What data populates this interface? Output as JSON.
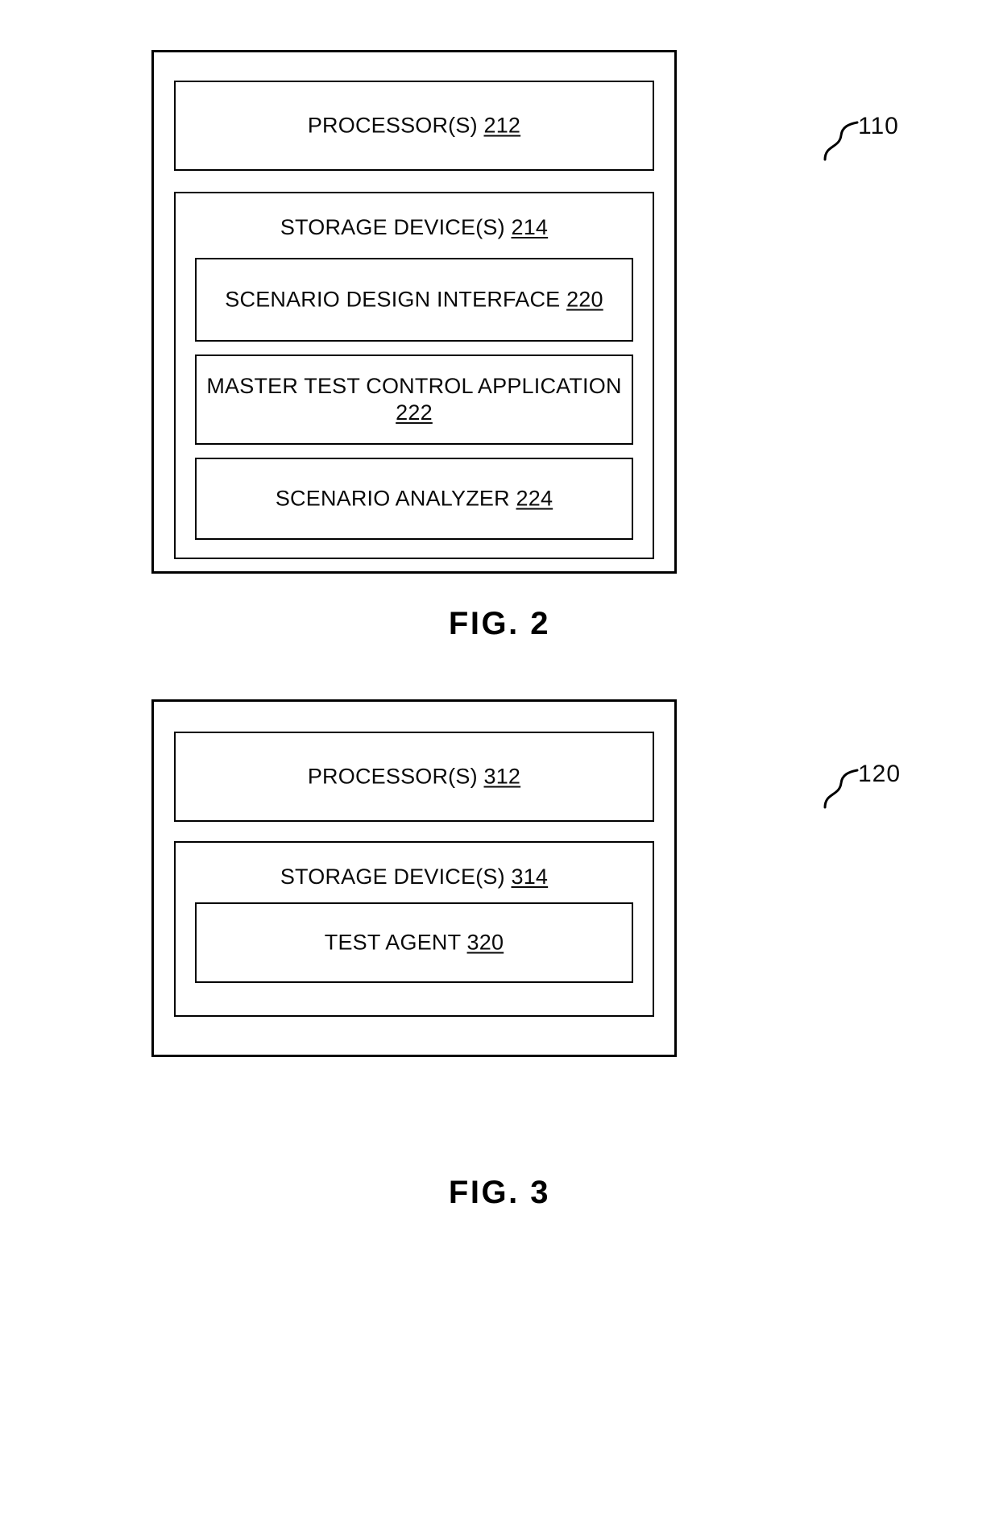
{
  "document": {
    "type": "patent-drawing-sheet",
    "background_color": "#ffffff",
    "line_color": "#000000"
  },
  "figures": [
    {
      "id": "fig2",
      "caption": "FIG. 2",
      "callout": "110",
      "blocks": {
        "processor": {
          "text": "PROCESSOR(S)",
          "ref": "212"
        },
        "storage": {
          "text": "STORAGE DEVICE(S)",
          "ref": "214"
        },
        "children": [
          {
            "text": "SCENARIO DESIGN INTERFACE",
            "ref": "220"
          },
          {
            "text": "MASTER TEST CONTROL APPLICATION",
            "ref": "222"
          },
          {
            "text": "SCENARIO ANALYZER",
            "ref": "224"
          }
        ]
      }
    },
    {
      "id": "fig3",
      "caption": "FIG. 3",
      "callout": "120",
      "blocks": {
        "processor": {
          "text": "PROCESSOR(S)",
          "ref": "312"
        },
        "storage": {
          "text": "STORAGE DEVICE(S)",
          "ref": "314"
        },
        "children": [
          {
            "text": "TEST AGENT",
            "ref": "320"
          }
        ]
      }
    }
  ],
  "fig2": {
    "caption": "FIG. 2",
    "callout": "110",
    "processor_text": "PROCESSOR(S)",
    "processor_ref": "212",
    "storage_text": "STORAGE DEVICE(S)",
    "storage_ref": "214",
    "sdi_text": "SCENARIO DESIGN INTERFACE",
    "sdi_ref": "220",
    "mtc_text": "MASTER TEST CONTROL APPLICATION",
    "mtc_ref": "222",
    "analyzer_text": "SCENARIO ANALYZER",
    "analyzer_ref": "224"
  },
  "fig3": {
    "caption": "FIG. 3",
    "callout": "120",
    "processor_text": "PROCESSOR(S)",
    "processor_ref": "312",
    "storage_text": "STORAGE DEVICE(S)",
    "storage_ref": "314",
    "agent_text": "TEST AGENT",
    "agent_ref": "320"
  }
}
